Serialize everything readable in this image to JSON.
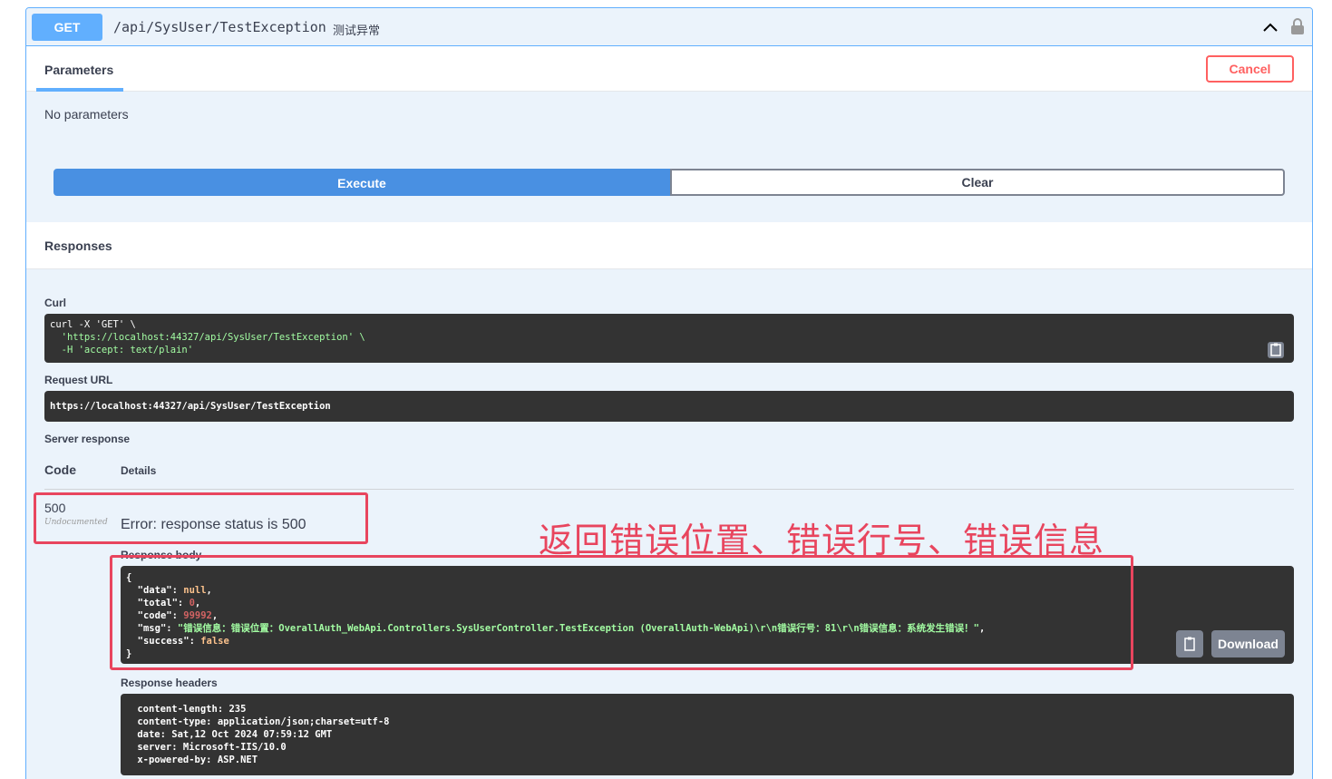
{
  "operation": {
    "method": "GET",
    "path": "/api/SysUser/TestException",
    "summary": "测试异常"
  },
  "tabs": {
    "parameters": "Parameters",
    "cancel": "Cancel",
    "no_params": "No parameters"
  },
  "actions": {
    "execute": "Execute",
    "clear": "Clear"
  },
  "responses": {
    "title": "Responses",
    "curl_label": "Curl",
    "curl_lines": [
      "curl -X 'GET' \\",
      "  'https://localhost:44327/api/SysUser/TestException' \\",
      "  -H 'accept: text/plain'"
    ],
    "request_url_label": "Request URL",
    "request_url": "https://localhost:44327/api/SysUser/TestException",
    "server_response_label": "Server response",
    "code_header": "Code",
    "details_header": "Details",
    "code": "500",
    "undocumented": "Undocumented",
    "error_text": "Error: response status is 500",
    "body_label": "Response body",
    "body": {
      "open": "{",
      "close": "}",
      "data_key": "\"data\"",
      "data_val": "null",
      "total_key": "\"total\"",
      "total_val": "0",
      "code_key": "\"code\"",
      "code_val": "99992",
      "msg_key": "\"msg\"",
      "msg_val": "\"错误信息：错误位置：OverallAuth_WebApi.Controllers.SysUserController.TestException (OverallAuth-WebApi)\\r\\n错误行号：81\\r\\n错误信息：系统发生错误！\"",
      "success_key": "\"success\"",
      "success_val": "false"
    },
    "download": "Download",
    "headers_label": "Response headers",
    "headers": [
      " content-length: 235",
      " content-type: application/json;charset=utf-8",
      " date: Sat,12 Oct 2024 07:59:12 GMT",
      " server: Microsoft-IIS/10.0",
      " x-powered-by: ASP.NET"
    ]
  },
  "annotation": "返回错误位置、错误行号、错误信息",
  "colors": {
    "get_blue": "#61affe",
    "execute_blue": "#4990e2",
    "cancel_red": "#ff6060",
    "annotation_red": "#e8455e"
  }
}
